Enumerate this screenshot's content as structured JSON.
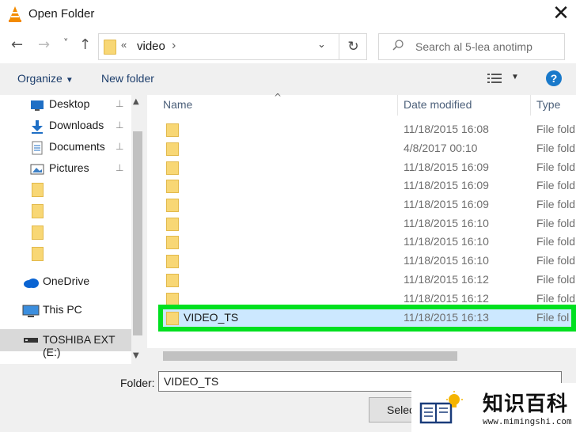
{
  "window": {
    "title": "Open Folder",
    "close_glyph": "✕"
  },
  "nav": {
    "back_glyph": "←",
    "forward_glyph": "→",
    "recent_glyph": "˅",
    "up_glyph": "↑",
    "address_chevrons": "«",
    "address_text": "video",
    "address_sep": "›",
    "address_dropdown": "⌄",
    "refresh_glyph": "↻",
    "search_placeholder": "Search al 5-lea anotimp"
  },
  "toolbar": {
    "organize": "Organize",
    "new_folder": "New folder",
    "help": "?"
  },
  "sidebar": {
    "items": [
      {
        "label": "Desktop",
        "icon": "desktop-icon",
        "pinned": true
      },
      {
        "label": "Downloads",
        "icon": "downloads-icon",
        "pinned": true
      },
      {
        "label": "Documents",
        "icon": "documents-icon",
        "pinned": true
      },
      {
        "label": "Pictures",
        "icon": "pictures-icon",
        "pinned": true
      },
      {
        "label": "",
        "icon": "folder-icon"
      },
      {
        "label": "",
        "icon": "folder-icon"
      },
      {
        "label": "",
        "icon": "folder-icon"
      },
      {
        "label": "",
        "icon": "folder-icon"
      },
      {
        "label": "OneDrive",
        "icon": "cloud-icon"
      },
      {
        "label": "This PC",
        "icon": "computer-icon"
      },
      {
        "label": "TOSHIBA EXT (E:)",
        "icon": "drive-icon",
        "selected": true
      }
    ],
    "pin_glyph": "📌"
  },
  "columns": {
    "name": "Name",
    "date": "Date modified",
    "type": "Type"
  },
  "files": [
    {
      "name": "",
      "date": "11/18/2015 16:08",
      "type": "File fold"
    },
    {
      "name": "",
      "date": "4/8/2017 00:10",
      "type": "File fold"
    },
    {
      "name": "",
      "date": "11/18/2015 16:09",
      "type": "File fold"
    },
    {
      "name": "",
      "date": "11/18/2015 16:09",
      "type": "File fold"
    },
    {
      "name": "",
      "date": "11/18/2015 16:09",
      "type": "File fold"
    },
    {
      "name": "",
      "date": "11/18/2015 16:10",
      "type": "File fold"
    },
    {
      "name": "",
      "date": "11/18/2015 16:10",
      "type": "File fold"
    },
    {
      "name": "",
      "date": "11/18/2015 16:10",
      "type": "File fold"
    },
    {
      "name": "",
      "date": "11/18/2015 16:12",
      "type": "File fold"
    },
    {
      "name": "",
      "date": "11/18/2015 16:12",
      "type": "File fold"
    },
    {
      "name": "VIDEO_TS",
      "date": "11/18/2015 16:13",
      "type": "File fol",
      "selected": true
    }
  ],
  "footer": {
    "folder_label": "Folder:",
    "folder_value": "VIDEO_TS",
    "select_button": "Selec"
  },
  "watermark": {
    "text": "知识百科",
    "url": "www.mimingshi.com"
  },
  "colors": {
    "highlight": "#00e020",
    "selection": "#cce8ff",
    "folder": "#f8d775",
    "accent": "#1979ca"
  }
}
